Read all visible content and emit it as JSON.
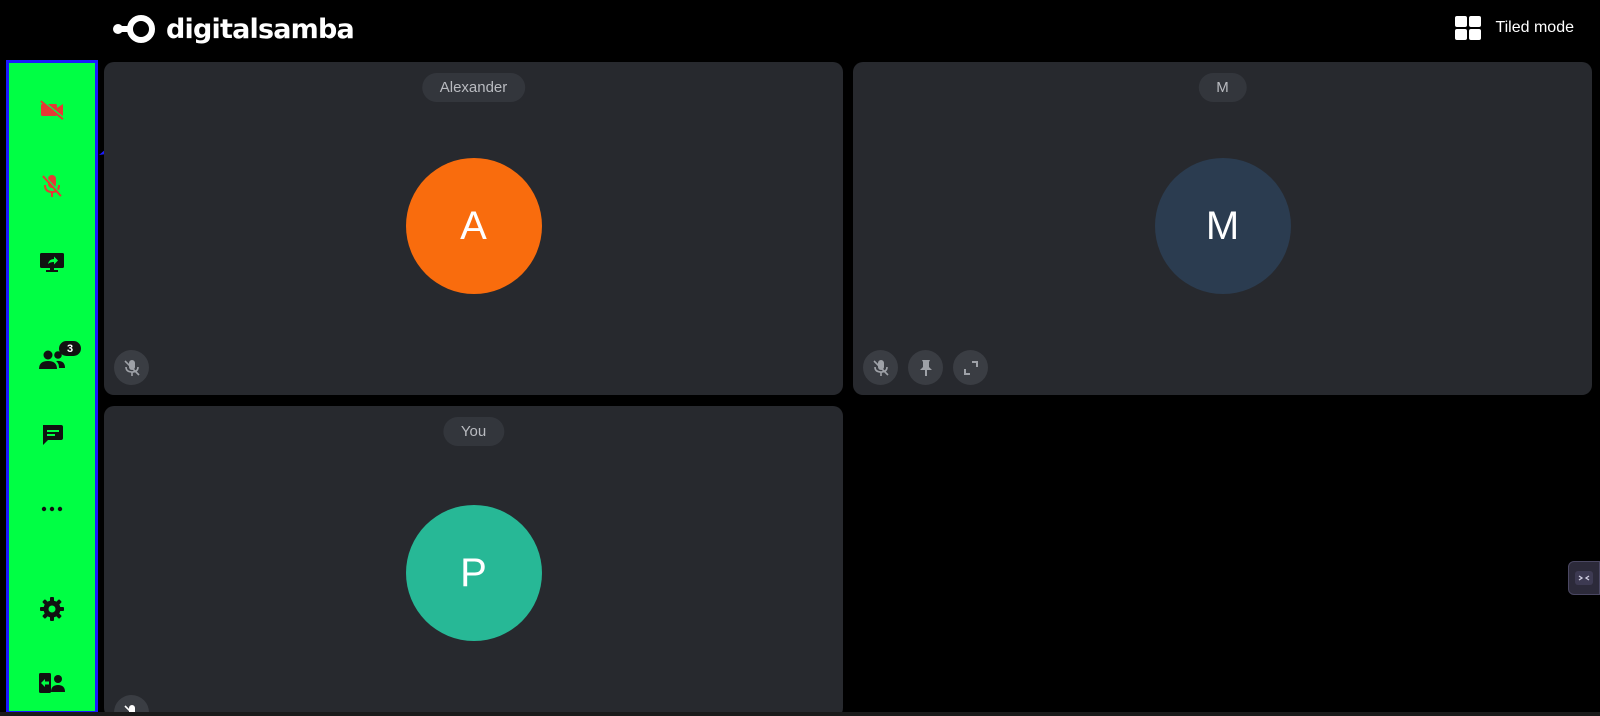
{
  "header": {
    "logo_text": "digitalsamba",
    "view_mode_label": "Tiled mode",
    "view_mode_icon": "grid-icon"
  },
  "sidebar": {
    "highlight_color": "#00ff44",
    "border_color": "#1a1aff",
    "items": [
      {
        "name": "camera-toggle",
        "icon": "video-off-icon",
        "state": "off",
        "color": "#e53935"
      },
      {
        "name": "mic-toggle",
        "icon": "mic-off-icon",
        "state": "off",
        "color": "#e53935"
      },
      {
        "name": "screen-share",
        "icon": "screen-share-icon"
      },
      {
        "name": "participants",
        "icon": "people-icon",
        "badge": "3"
      },
      {
        "name": "chat",
        "icon": "chat-icon"
      },
      {
        "name": "more",
        "icon": "more-icon"
      },
      {
        "name": "settings",
        "icon": "gear-icon"
      },
      {
        "name": "user-management",
        "icon": "user-settings-icon"
      }
    ]
  },
  "tiles": [
    {
      "name": "Alexander",
      "initial": "A",
      "avatar_color": "#f96c0d",
      "controls": [
        "mic-off-icon"
      ]
    },
    {
      "name": "M",
      "initial": "M",
      "avatar_color": "#2b3c50",
      "controls": [
        "mic-off-icon",
        "pin-icon",
        "fullscreen-icon"
      ]
    },
    {
      "name": "You",
      "initial": "P",
      "avatar_color": "#27b896",
      "controls": [
        "mic-off-icon"
      ]
    }
  ]
}
